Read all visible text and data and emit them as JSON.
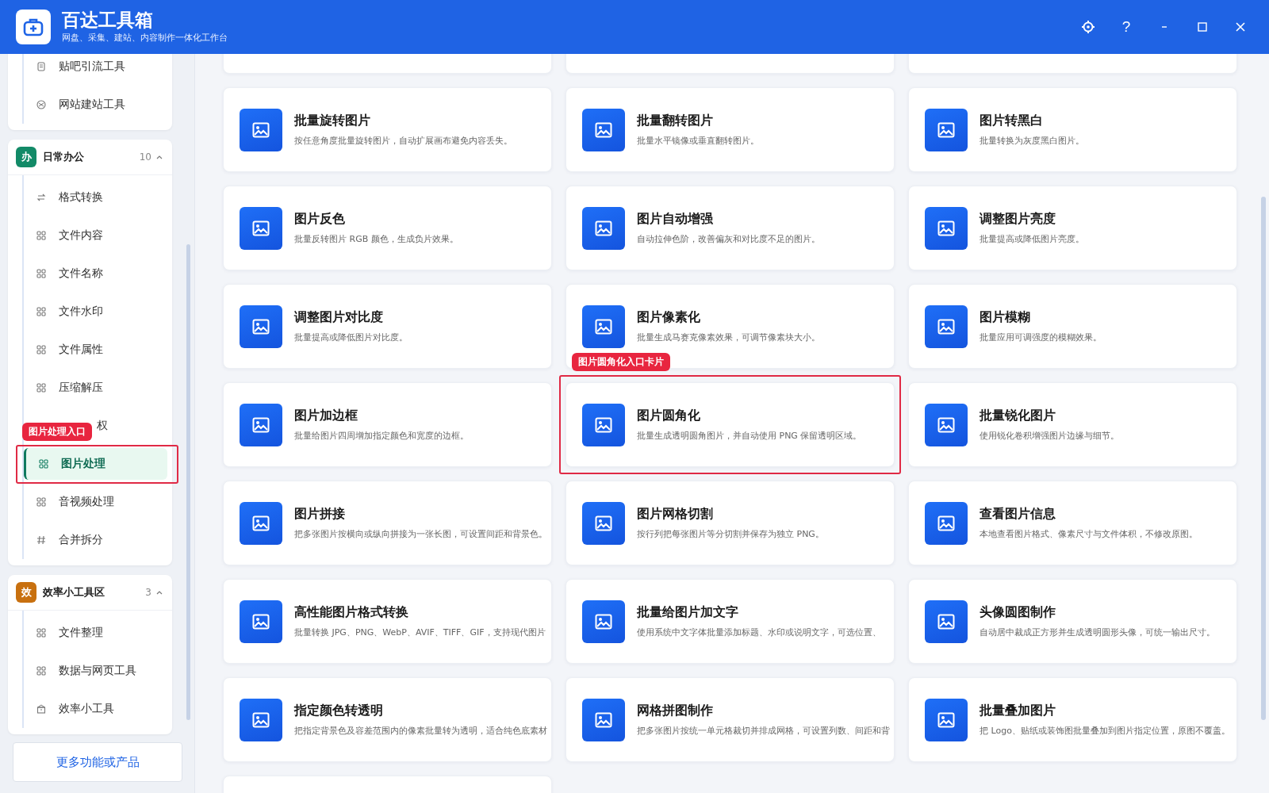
{
  "app": {
    "title": "百达工具箱",
    "subtitle": "网盘、采集、建站、内容制作一体化工作台"
  },
  "window_controls": [
    {
      "kind": "settings"
    },
    {
      "kind": "text",
      "label": "?"
    },
    {
      "kind": "minimize"
    },
    {
      "kind": "maximize"
    },
    {
      "kind": "close"
    }
  ],
  "sidebar": {
    "groups": [
      {
        "kind": "cut",
        "items": [
          {
            "label": "贴吧引流工具",
            "kind": "doc",
            "selected": false
          },
          {
            "label": "网站建站工具",
            "kind": "globe",
            "selected": false
          }
        ]
      },
      {
        "kind": "full",
        "badge": "办",
        "color": "#128a67",
        "title": "日常办公",
        "count": "10",
        "expanded": true,
        "items": [
          {
            "label": "格式转换",
            "kind": "swap",
            "selected": false
          },
          {
            "label": "文件内容",
            "kind": "grid",
            "selected": false
          },
          {
            "label": "文件名称",
            "kind": "grid",
            "selected": false
          },
          {
            "label": "文件水印",
            "kind": "grid",
            "selected": false
          },
          {
            "label": "文件属性",
            "kind": "grid",
            "selected": false
          },
          {
            "label": "压缩解压",
            "kind": "grid",
            "selected": false
          },
          {
            "label": "权",
            "kind": "covered",
            "selected": false
          },
          {
            "label": "图片处理",
            "kind": "grid",
            "selected": true,
            "annotation": "图片处理入口"
          },
          {
            "label": "音视频处理",
            "kind": "grid",
            "selected": false
          },
          {
            "label": "合并拆分",
            "kind": "hash",
            "selected": false
          }
        ]
      },
      {
        "kind": "full",
        "badge": "效",
        "color": "#c8700f",
        "title": "效率小工具区",
        "count": "3",
        "expanded": true,
        "items": [
          {
            "label": "文件整理",
            "kind": "grid",
            "selected": false
          },
          {
            "label": "数据与网页工具",
            "kind": "grid",
            "selected": false
          },
          {
            "label": "效率小工具",
            "kind": "box",
            "selected": false
          }
        ]
      }
    ],
    "more_button": "更多功能或产品"
  },
  "cards": [
    {
      "kind": "blank"
    },
    {
      "kind": "blank"
    },
    {
      "kind": "blank"
    },
    {
      "kind": "tool",
      "title": "批量旋转图片",
      "desc": "按任意角度批量旋转图片，自动扩展画布避免内容丢失。"
    },
    {
      "kind": "tool",
      "title": "批量翻转图片",
      "desc": "批量水平镜像或垂直翻转图片。"
    },
    {
      "kind": "tool",
      "title": "图片转黑白",
      "desc": "批量转换为灰度黑白图片。"
    },
    {
      "kind": "tool",
      "title": "图片反色",
      "desc": "批量反转图片 RGB 颜色，生成负片效果。"
    },
    {
      "kind": "tool",
      "title": "图片自动增强",
      "desc": "自动拉伸色阶，改善偏灰和对比度不足的图片。"
    },
    {
      "kind": "tool",
      "title": "调整图片亮度",
      "desc": "批量提高或降低图片亮度。"
    },
    {
      "kind": "tool",
      "title": "调整图片对比度",
      "desc": "批量提高或降低图片对比度。"
    },
    {
      "kind": "tool",
      "title": "图片像素化",
      "desc": "批量生成马赛克像素效果，可调节像素块大小。"
    },
    {
      "kind": "tool",
      "title": "图片模糊",
      "desc": "批量应用可调强度的模糊效果。"
    },
    {
      "kind": "tool",
      "title": "图片加边框",
      "desc": "批量给图片四周增加指定颜色和宽度的边框。"
    },
    {
      "kind": "tool",
      "title": "图片圆角化",
      "desc": "批量生成透明圆角图片，并自动使用 PNG 保留透明区域。",
      "annotation": "图片圆角化入口卡片"
    },
    {
      "kind": "tool",
      "title": "批量锐化图片",
      "desc": "使用锐化卷积增强图片边缘与细节。"
    },
    {
      "kind": "tool",
      "title": "图片拼接",
      "desc": "把多张图片按横向或纵向拼接为一张长图，可设置间距和背景色。"
    },
    {
      "kind": "tool",
      "title": "图片网格切割",
      "desc": "按行列把每张图片等分切割并保存为独立 PNG。"
    },
    {
      "kind": "tool",
      "title": "查看图片信息",
      "desc": "本地查看图片格式、像素尺寸与文件体积，不修改原图。"
    },
    {
      "kind": "tool",
      "title": "高性能图片格式转换",
      "desc": "批量转换 JPG、PNG、WebP、AVIF、TIFF、GIF，支持现代图片"
    },
    {
      "kind": "tool",
      "title": "批量给图片加文字",
      "desc": "使用系统中文字体批量添加标题、水印或说明文字，可选位置、"
    },
    {
      "kind": "tool",
      "title": "头像圆图制作",
      "desc": "自动居中裁成正方形并生成透明圆形头像，可统一输出尺寸。"
    },
    {
      "kind": "tool",
      "title": "指定颜色转透明",
      "desc": "把指定背景色及容差范围内的像素批量转为透明，适合纯色底素材"
    },
    {
      "kind": "tool",
      "title": "网格拼图制作",
      "desc": "把多张图片按统一单元格裁切并排成网格，可设置列数、间距和背"
    },
    {
      "kind": "tool",
      "title": "批量叠加图片",
      "desc": "把 Logo、贴纸或装饰图批量叠加到图片指定位置，原图不覆盖。"
    },
    {
      "kind": "blank"
    }
  ]
}
